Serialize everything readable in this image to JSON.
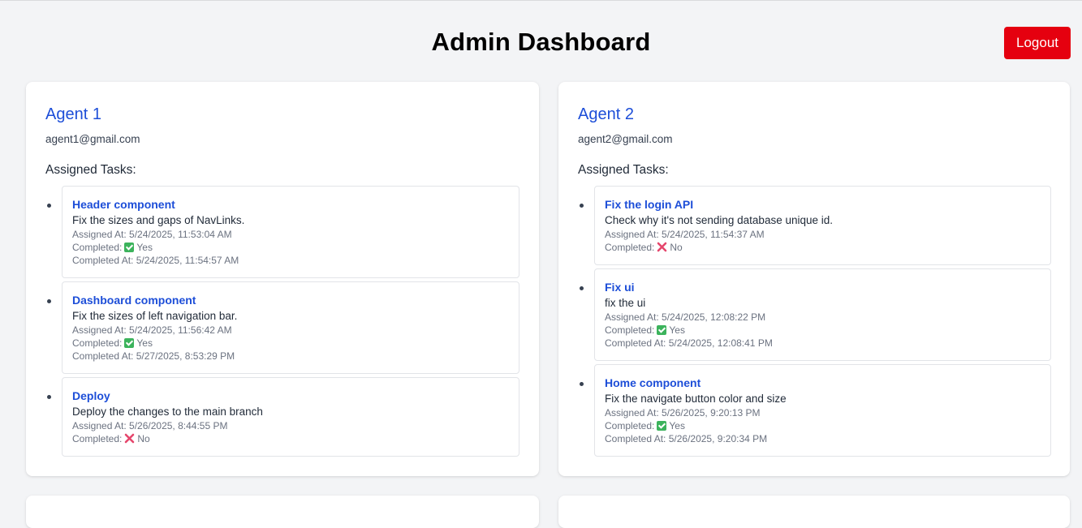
{
  "header": {
    "title": "Admin Dashboard",
    "logout_label": "Logout"
  },
  "labels": {
    "assigned_tasks": "Assigned Tasks:",
    "assigned_at_prefix": "Assigned At: ",
    "completed_prefix": "Completed:",
    "completed_at_prefix": "Completed At: "
  },
  "colors": {
    "accent": "#1d4ed8",
    "logout_bg": "#e5000f",
    "check_green": "#3cb35c",
    "cross_red": "#e5466c"
  },
  "agents": [
    {
      "name": "Agent 1",
      "email": "agent1@gmail.com",
      "tasks": [
        {
          "title": "Header component",
          "description": "Fix the sizes and gaps of NavLinks.",
          "assigned_at": "5/24/2025, 11:53:04 AM",
          "completed": "Yes",
          "completed_icon": "check-icon",
          "completed_at": "5/24/2025, 11:54:57 AM"
        },
        {
          "title": "Dashboard component",
          "description": "Fix the sizes of left navigation bar.",
          "assigned_at": "5/24/2025, 11:56:42 AM",
          "completed": "Yes",
          "completed_icon": "check-icon",
          "completed_at": "5/27/2025, 8:53:29 PM"
        },
        {
          "title": "Deploy",
          "description": "Deploy the changes to the main branch",
          "assigned_at": "5/26/2025, 8:44:55 PM",
          "completed": "No",
          "completed_icon": "cross-icon"
        }
      ]
    },
    {
      "name": "Agent 2",
      "email": "agent2@gmail.com",
      "tasks": [
        {
          "title": "Fix the login API",
          "description": "Check why it's not sending database unique id.",
          "assigned_at": "5/24/2025, 11:54:37 AM",
          "completed": "No",
          "completed_icon": "cross-icon"
        },
        {
          "title": "Fix ui",
          "description": "fix the ui",
          "assigned_at": "5/24/2025, 12:08:22 PM",
          "completed": "Yes",
          "completed_icon": "check-icon",
          "completed_at": "5/24/2025, 12:08:41 PM"
        },
        {
          "title": "Home component",
          "description": "Fix the navigate button color and size",
          "assigned_at": "5/26/2025, 9:20:13 PM",
          "completed": "Yes",
          "completed_icon": "check-icon",
          "completed_at": "5/26/2025, 9:20:34 PM"
        }
      ]
    }
  ]
}
